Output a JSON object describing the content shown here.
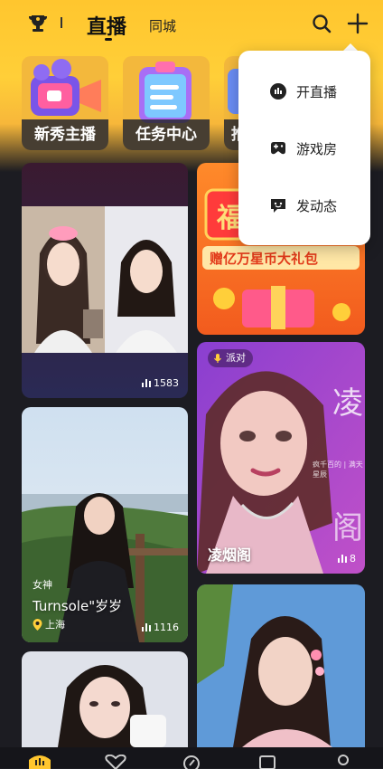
{
  "header": {
    "tab_live": "直播",
    "tab_city": "同城"
  },
  "features": [
    {
      "label": "新秀主播"
    },
    {
      "label": "任务中心"
    },
    {
      "label": "推"
    }
  ],
  "popup_menu": {
    "items": [
      {
        "label": "开直播",
        "icon": "live-icon"
      },
      {
        "label": "游戏房",
        "icon": "gamepad-icon"
      },
      {
        "label": "发动态",
        "icon": "post-icon"
      }
    ]
  },
  "cards": {
    "c1": {
      "viewers": "1583"
    },
    "c2": {
      "banner": "赠亿万星币大礼包",
      "badge": "福"
    },
    "c3": {
      "tag": "派对",
      "title": "凌烟阁",
      "viewers": "8",
      "art_text": "凌",
      "art_text2": "阁",
      "art_small": "疯千百的 | 满天星辰"
    },
    "c4": {
      "caption": "女神",
      "title": "Turnsole\"岁岁",
      "location": "上海",
      "viewers": "1116"
    }
  },
  "colors": {
    "brand_yellow": "#ffc62e",
    "background": "#1c1c22"
  }
}
